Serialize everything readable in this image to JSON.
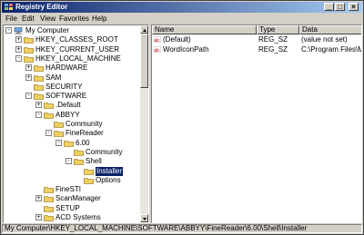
{
  "window": {
    "title": "Registry Editor"
  },
  "menu": [
    "File",
    "Edit",
    "View",
    "Favorites",
    "Help"
  ],
  "tree": [
    {
      "label": "My Computer",
      "depth": 0,
      "expander": "-",
      "icon": "computer-icon"
    },
    {
      "label": "HKEY_CLASSES_ROOT",
      "depth": 1,
      "expander": "+"
    },
    {
      "label": "HKEY_CURRENT_USER",
      "depth": 1,
      "expander": "+"
    },
    {
      "label": "HKEY_LOCAL_MACHINE",
      "depth": 1,
      "expander": "-"
    },
    {
      "label": "HARDWARE",
      "depth": 2,
      "expander": "+"
    },
    {
      "label": "SAM",
      "depth": 2,
      "expander": "+"
    },
    {
      "label": "SECURITY",
      "depth": 2,
      "expander": ""
    },
    {
      "label": "SOFTWARE",
      "depth": 2,
      "expander": "-"
    },
    {
      "label": ".Default",
      "depth": 3,
      "expander": "+"
    },
    {
      "label": "ABBYY",
      "depth": 3,
      "expander": "-"
    },
    {
      "label": "Community",
      "depth": 4,
      "expander": ""
    },
    {
      "label": "FineReader",
      "depth": 4,
      "expander": "-"
    },
    {
      "label": "6.00",
      "depth": 5,
      "expander": "-"
    },
    {
      "label": "Community",
      "depth": 6,
      "expander": ""
    },
    {
      "label": "Shell",
      "depth": 6,
      "expander": "-"
    },
    {
      "label": "Installer",
      "depth": 7,
      "expander": "",
      "selected": true
    },
    {
      "label": "Options",
      "depth": 7,
      "expander": ""
    },
    {
      "label": "FineSTI",
      "depth": 3,
      "expander": ""
    },
    {
      "label": "ScanManager",
      "depth": 3,
      "expander": "+"
    },
    {
      "label": "SETUP",
      "depth": 3,
      "expander": ""
    },
    {
      "label": "ACD Systems",
      "depth": 3,
      "expander": "+"
    }
  ],
  "columns": [
    "Name",
    "Type",
    "Data"
  ],
  "values": [
    {
      "name": "(Default)",
      "type": "REG_SZ",
      "data": "(value not set)"
    },
    {
      "name": "WordIconPath",
      "type": "REG_SZ",
      "data": "C:\\Program Files\\Micro"
    }
  ],
  "status": "My Computer\\HKEY_LOCAL_MACHINE\\SOFTWARE\\ABBYY\\FineReader\\6.00\\Shell\\Installer",
  "colors": {
    "title_start": "#0a246a",
    "title_end": "#a6caf0",
    "folder": "#f0d060",
    "selection": "#0a246a"
  }
}
